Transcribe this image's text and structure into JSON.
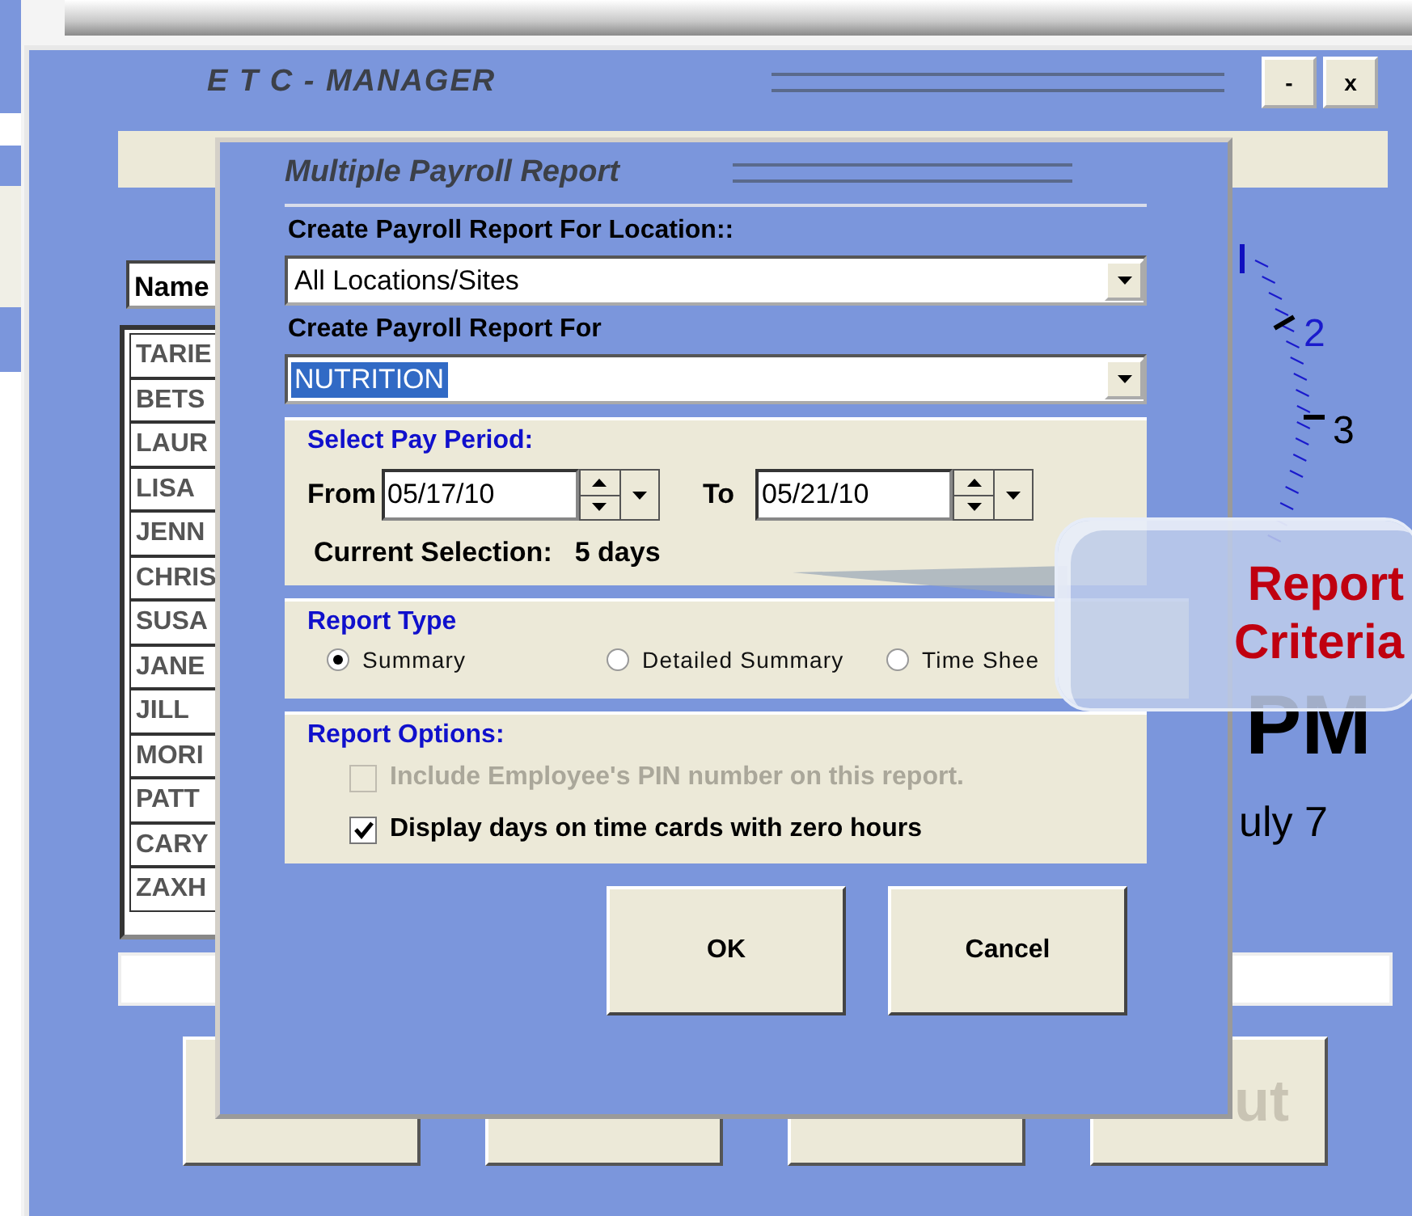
{
  "main_window": {
    "title": "E T C - MANAGER",
    "window_buttons": [
      "-",
      "x"
    ],
    "name_header": "Name",
    "employees": [
      "TARIE",
      "BETS",
      "LAUR",
      "LISA",
      "JENN",
      "CHRIS",
      "SUSA",
      "JANE",
      "JILL",
      "MORI",
      "PATT",
      "CARY",
      "ZAXH"
    ],
    "clock": {
      "numbers": [
        "2",
        "3"
      ],
      "period": "PM",
      "date": "uly 7"
    },
    "bottom_buttons": [
      {
        "kind": "blank"
      },
      {
        "kind": "blank"
      },
      {
        "kind": "blank"
      },
      {
        "kind": "text",
        "label": "ut"
      }
    ]
  },
  "dialog": {
    "title": "Multiple Payroll Report",
    "location_label": "Create Payroll Report For Location::",
    "location_value": "All Locations/Sites",
    "report_for_label": "Create Payroll Report For",
    "report_for_value": "NUTRITION",
    "report_for_highlighted": true,
    "pay_period": {
      "title": "Select Pay Period:",
      "from_label": "From",
      "from_value": "05/17/10",
      "to_label": "To",
      "to_value": "05/21/10",
      "selection_label": "Current Selection:",
      "selection_value": "5 days"
    },
    "report_type": {
      "title": "Report Type",
      "options": [
        {
          "label": "Summary",
          "selected": true
        },
        {
          "label": "Detailed Summary",
          "selected": false
        },
        {
          "label": "Time Shee",
          "selected": false
        }
      ]
    },
    "report_options": {
      "title": "Report Options:",
      "options": [
        {
          "label": "Include Employee's PIN number on this report.",
          "checked": false,
          "disabled": true
        },
        {
          "label": "Display days on time cards with zero hours",
          "checked": true,
          "disabled": false
        }
      ]
    },
    "buttons": [
      "OK",
      "Cancel"
    ]
  },
  "callout": {
    "lines": [
      "Report",
      "Criteria"
    ]
  }
}
